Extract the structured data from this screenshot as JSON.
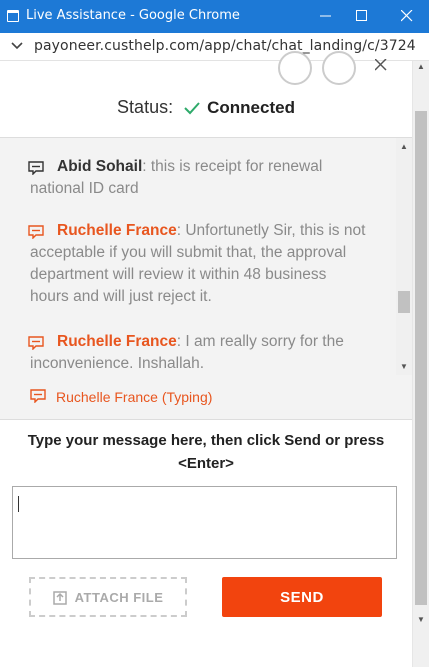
{
  "window": {
    "title": "Live Assistance - Google Chrome",
    "url": "payoneer.custhelp.com/app/chat/chat_landing/c/3724"
  },
  "status": {
    "label": "Status:",
    "value": "Connected"
  },
  "transcript": [
    {
      "name": "Abid Sohail",
      "text": ": this is receipt for renewal national ID card",
      "role": "user"
    },
    {
      "name": "Ruchelle France",
      "text": ": Unfortunetly Sir, this is not acceptable if you will submit that, the approval department will review it within 48 business hours and will just reject it.",
      "role": "agent"
    },
    {
      "name": "Ruchelle France",
      "text": ": I am really sorry for the inconvenience. Inshallah.",
      "role": "agent"
    }
  ],
  "typing": "Ruchelle France (Typing)",
  "instructions": "Type your message here, then click Send or press <Enter>",
  "message_input": {
    "value": ""
  },
  "buttons": {
    "attach": "ATTACH FILE",
    "send": "SEND"
  },
  "colors": {
    "agent": "#e8561f",
    "send": "#f2440e",
    "titlebar": "#1d79d6",
    "connected_check": "#2eaa6a"
  }
}
